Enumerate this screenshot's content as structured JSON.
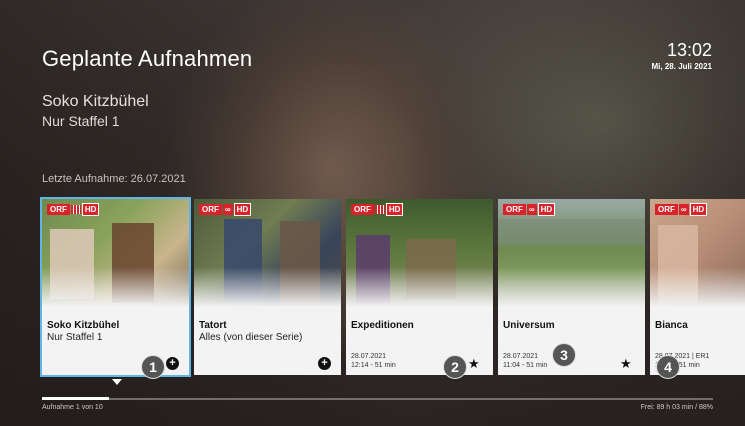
{
  "header": {
    "title": "Geplante Aufnahmen",
    "time": "13:02",
    "date": "Mi, 28. Juli 2021"
  },
  "detail": {
    "show": "Soko Kitzbühel",
    "season": "Nur Staffel 1",
    "last_recording": "Letzte Aufnahme: 26.07.2021"
  },
  "cards": [
    {
      "channel_logo": "ORF III HD",
      "title": "Soko Kitzbühel",
      "subtitle": "Nur Staffel 1",
      "date": "",
      "time": "",
      "icon": "add-icon",
      "icon_glyph": "+",
      "callout": "1",
      "selected": true
    },
    {
      "channel_logo": "ORF 2 HD",
      "title": "Tatort",
      "subtitle": "Alles (von dieser Serie)",
      "date": "",
      "time": "",
      "icon": "add-icon",
      "icon_glyph": "+",
      "callout": "",
      "selected": false
    },
    {
      "channel_logo": "ORF III HD",
      "title": "Expeditionen",
      "subtitle": "",
      "date": "28.07.2021",
      "time": "12:14 - 51 min",
      "icon": "star-icon",
      "icon_glyph": "★",
      "callout": "2",
      "selected": false
    },
    {
      "channel_logo": "ORF 2 HD",
      "title": "Universum",
      "subtitle": "",
      "date": "28.07.2021",
      "time": "11:04 - 51 min",
      "icon": "star-icon",
      "icon_glyph": "★",
      "callout": "3",
      "selected": false
    },
    {
      "channel_logo": "ORF 2 HD",
      "title": "Bianca",
      "subtitle": "",
      "date": "28.07.2021 | ER1",
      "time": "12:00 - 51 min",
      "icon": "",
      "icon_glyph": "",
      "callout": "4",
      "selected": false
    }
  ],
  "footer": {
    "position": "Aufnahme 1 von 10",
    "progress": 0.1,
    "storage": "Frei: 89 h 03 min / 88%"
  },
  "colors": {
    "accent": "#5fb6e6",
    "orf_red": "#d8232a"
  }
}
